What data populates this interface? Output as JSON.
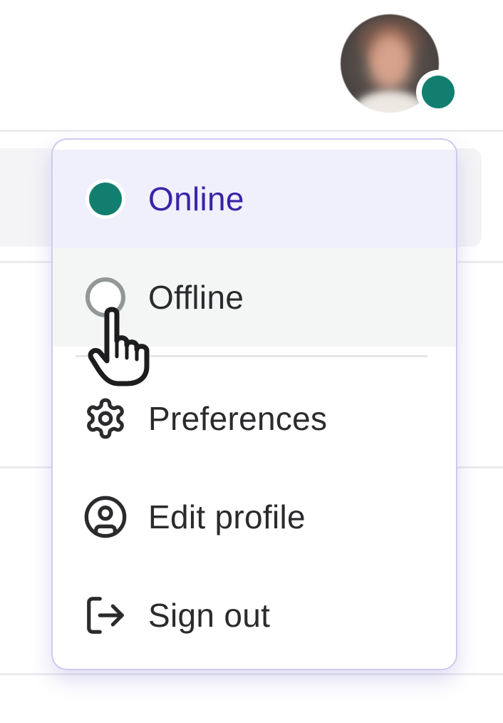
{
  "user": {
    "avatar_name": "user-avatar",
    "status": "online",
    "status_color": "#127e70"
  },
  "menu": {
    "items": [
      {
        "id": "online",
        "label": "Online",
        "icon": "status-online-dot",
        "color": "#3a24a6",
        "selected": true
      },
      {
        "id": "offline",
        "label": "Offline",
        "icon": "status-offline-dot",
        "hovered": true
      },
      {
        "id": "preferences",
        "label": "Preferences",
        "icon": "gear-icon"
      },
      {
        "id": "edit-profile",
        "label": "Edit profile",
        "icon": "user-circle-icon"
      },
      {
        "id": "sign-out",
        "label": "Sign out",
        "icon": "sign-out-icon"
      }
    ]
  },
  "colors": {
    "accent": "#3a24a6",
    "online": "#127e70",
    "selected_bg": "#f0effc",
    "menu_border": "#cdcaf1",
    "text": "#2b2b2e"
  },
  "cursor": "pointer-hand-icon"
}
